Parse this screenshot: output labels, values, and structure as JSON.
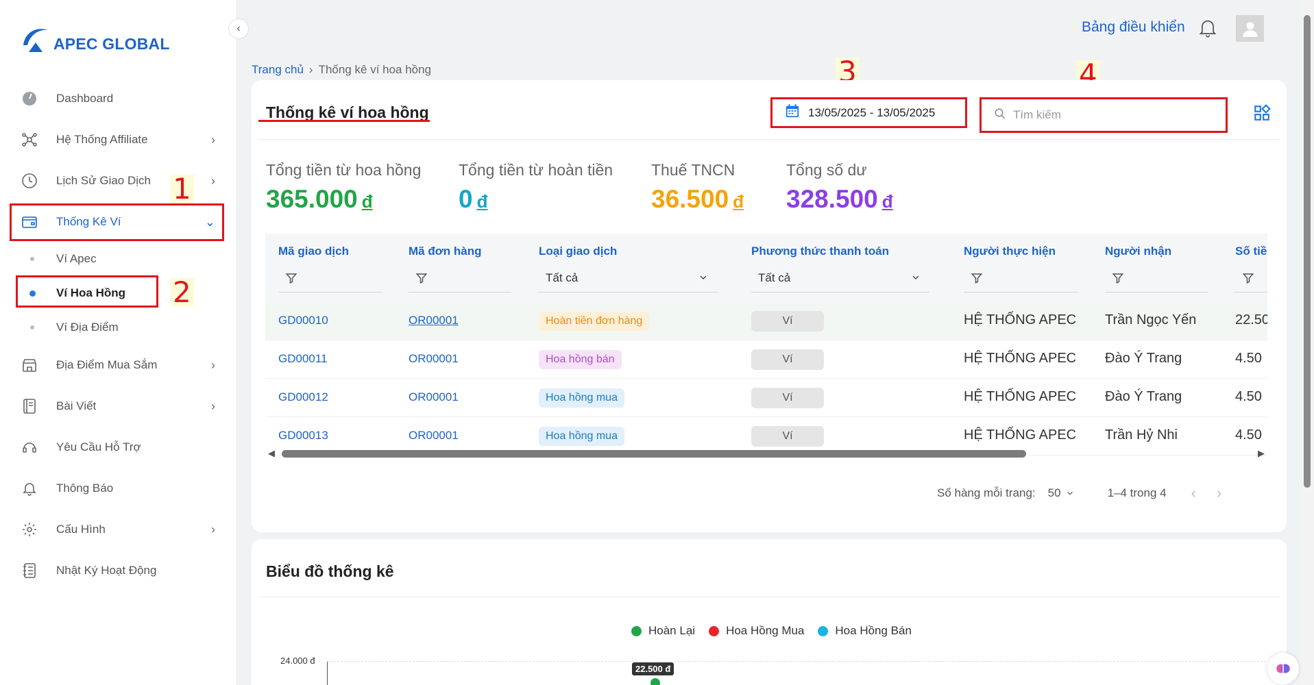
{
  "app": {
    "logo_text": "APEC GLOBAL"
  },
  "sidebar": {
    "items": [
      {
        "label": "Dashboard",
        "icon": "dashboard-icon"
      },
      {
        "label": "Hệ Thống Affiliate",
        "icon": "network-icon"
      },
      {
        "label": "Lịch Sử Giao Dịch",
        "icon": "clock-icon"
      },
      {
        "label": "Thống Kê Ví",
        "icon": "wallet-icon"
      },
      {
        "label": "Địa Điểm Mua Sắm",
        "icon": "store-icon"
      },
      {
        "label": "Bài Viết",
        "icon": "article-icon"
      },
      {
        "label": "Yêu Cầu Hỗ Trợ",
        "icon": "support-icon"
      },
      {
        "label": "Thông Báo",
        "icon": "bell-icon"
      },
      {
        "label": "Cấu Hình",
        "icon": "gear-icon"
      },
      {
        "label": "Nhật Ký Hoạt Động",
        "icon": "log-icon"
      }
    ],
    "sub_items": [
      {
        "label": "Ví Apec"
      },
      {
        "label": "Ví Hoa Hồng"
      },
      {
        "label": "Ví Địa Điểm"
      }
    ]
  },
  "annotations": [
    "1",
    "2",
    "3",
    "4"
  ],
  "header": {
    "dashboard_link": "Bảng điều khiển"
  },
  "breadcrumb": {
    "home": "Trang chủ",
    "current": "Thống kê ví hoa hồng"
  },
  "page": {
    "title": "Thống kê ví hoa hồng",
    "date_range": "13/05/2025 - 13/05/2025",
    "search_placeholder": "Tìm kiếm"
  },
  "stats": [
    {
      "label": "Tổng tiền từ hoa hồng",
      "value": "365.000",
      "currency": "đ",
      "color": "#22a546"
    },
    {
      "label": "Tổng tiền từ hoàn tiền",
      "value": "0",
      "currency": "đ",
      "color": "#12a5c9"
    },
    {
      "label": "Thuế TNCN",
      "value": "36.500",
      "currency": "đ",
      "color": "#f5a30b"
    },
    {
      "label": "Tổng số dư",
      "value": "328.500",
      "currency": "đ",
      "color": "#8b3ee8"
    }
  ],
  "table": {
    "columns": [
      "Mã giao dịch",
      "Mã đơn hàng",
      "Loại giao dịch",
      "Phương thức thanh toán",
      "Người thực hiện",
      "Người nhận",
      "Số tiề"
    ],
    "filters": {
      "type": "Tất cả",
      "payment": "Tất cả"
    },
    "rows": [
      {
        "code": "GD00010",
        "order": "OR00001",
        "type": "Hoàn tiền đơn hàng",
        "payment": "Ví",
        "by": "HỆ THỐNG APEC",
        "to": "Trần Ngọc Yến",
        "amount": "22.50"
      },
      {
        "code": "GD00011",
        "order": "OR00001",
        "type": "Hoa hồng bán",
        "payment": "Ví",
        "by": "HỆ THỐNG APEC",
        "to": "Đào Ý Trang",
        "amount": "4.50"
      },
      {
        "code": "GD00012",
        "order": "OR00001",
        "type": "Hoa hồng mua",
        "payment": "Ví",
        "by": "HỆ THỐNG APEC",
        "to": "Đào Ý Trang",
        "amount": "4.50"
      },
      {
        "code": "GD00013",
        "order": "OR00001",
        "type": "Hoa hồng mua",
        "payment": "Ví",
        "by": "HỆ THỐNG APEC",
        "to": "Trần Hỷ Nhi",
        "amount": "4.50"
      }
    ],
    "badge_colors": {
      "Hoàn tiền đơn hàng": {
        "bg": "#fdf0d8",
        "fg": "#f08c0c"
      },
      "Hoa hồng bán": {
        "bg": "#f6e3f8",
        "fg": "#b04fc6"
      },
      "Hoa hồng mua": {
        "bg": "#e1f0fb",
        "fg": "#1e7bc6"
      }
    }
  },
  "pagination": {
    "rows_label": "Số hàng mỗi trang:",
    "rows_value": "50",
    "range": "1–4 trong 4"
  },
  "chart": {
    "title": "Biểu đồ thống kê",
    "legend": [
      {
        "name": "Hoàn Lại",
        "color": "#22a546"
      },
      {
        "name": "Hoa Hồng Mua",
        "color": "#e8252b"
      },
      {
        "name": "Hoa Hồng Bán",
        "color": "#1ab4e0"
      }
    ],
    "y_tick": "24.000 đ",
    "tooltip": "22.500 đ"
  }
}
